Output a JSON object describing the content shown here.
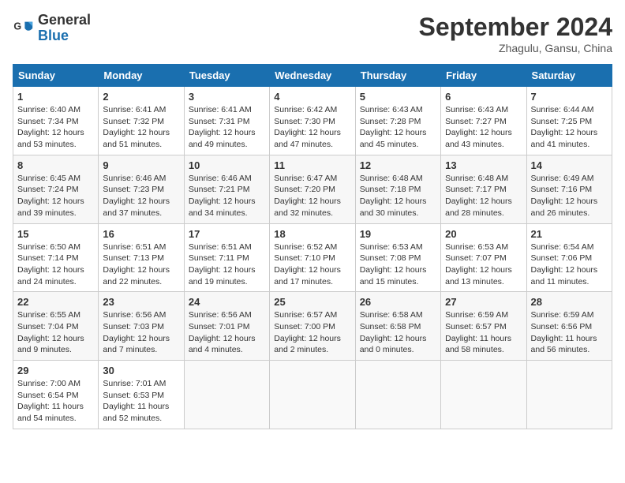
{
  "logo": {
    "line1": "General",
    "line2": "Blue"
  },
  "title": "September 2024",
  "location": "Zhagulu, Gansu, China",
  "weekdays": [
    "Sunday",
    "Monday",
    "Tuesday",
    "Wednesday",
    "Thursday",
    "Friday",
    "Saturday"
  ],
  "weeks": [
    [
      {
        "day": "1",
        "sunrise": "6:40 AM",
        "sunset": "7:34 PM",
        "daylight": "12 hours and 53 minutes."
      },
      {
        "day": "2",
        "sunrise": "6:41 AM",
        "sunset": "7:32 PM",
        "daylight": "12 hours and 51 minutes."
      },
      {
        "day": "3",
        "sunrise": "6:41 AM",
        "sunset": "7:31 PM",
        "daylight": "12 hours and 49 minutes."
      },
      {
        "day": "4",
        "sunrise": "6:42 AM",
        "sunset": "7:30 PM",
        "daylight": "12 hours and 47 minutes."
      },
      {
        "day": "5",
        "sunrise": "6:43 AM",
        "sunset": "7:28 PM",
        "daylight": "12 hours and 45 minutes."
      },
      {
        "day": "6",
        "sunrise": "6:43 AM",
        "sunset": "7:27 PM",
        "daylight": "12 hours and 43 minutes."
      },
      {
        "day": "7",
        "sunrise": "6:44 AM",
        "sunset": "7:25 PM",
        "daylight": "12 hours and 41 minutes."
      }
    ],
    [
      {
        "day": "8",
        "sunrise": "6:45 AM",
        "sunset": "7:24 PM",
        "daylight": "12 hours and 39 minutes."
      },
      {
        "day": "9",
        "sunrise": "6:46 AM",
        "sunset": "7:23 PM",
        "daylight": "12 hours and 37 minutes."
      },
      {
        "day": "10",
        "sunrise": "6:46 AM",
        "sunset": "7:21 PM",
        "daylight": "12 hours and 34 minutes."
      },
      {
        "day": "11",
        "sunrise": "6:47 AM",
        "sunset": "7:20 PM",
        "daylight": "12 hours and 32 minutes."
      },
      {
        "day": "12",
        "sunrise": "6:48 AM",
        "sunset": "7:18 PM",
        "daylight": "12 hours and 30 minutes."
      },
      {
        "day": "13",
        "sunrise": "6:48 AM",
        "sunset": "7:17 PM",
        "daylight": "12 hours and 28 minutes."
      },
      {
        "day": "14",
        "sunrise": "6:49 AM",
        "sunset": "7:16 PM",
        "daylight": "12 hours and 26 minutes."
      }
    ],
    [
      {
        "day": "15",
        "sunrise": "6:50 AM",
        "sunset": "7:14 PM",
        "daylight": "12 hours and 24 minutes."
      },
      {
        "day": "16",
        "sunrise": "6:51 AM",
        "sunset": "7:13 PM",
        "daylight": "12 hours and 22 minutes."
      },
      {
        "day": "17",
        "sunrise": "6:51 AM",
        "sunset": "7:11 PM",
        "daylight": "12 hours and 19 minutes."
      },
      {
        "day": "18",
        "sunrise": "6:52 AM",
        "sunset": "7:10 PM",
        "daylight": "12 hours and 17 minutes."
      },
      {
        "day": "19",
        "sunrise": "6:53 AM",
        "sunset": "7:08 PM",
        "daylight": "12 hours and 15 minutes."
      },
      {
        "day": "20",
        "sunrise": "6:53 AM",
        "sunset": "7:07 PM",
        "daylight": "12 hours and 13 minutes."
      },
      {
        "day": "21",
        "sunrise": "6:54 AM",
        "sunset": "7:06 PM",
        "daylight": "12 hours and 11 minutes."
      }
    ],
    [
      {
        "day": "22",
        "sunrise": "6:55 AM",
        "sunset": "7:04 PM",
        "daylight": "12 hours and 9 minutes."
      },
      {
        "day": "23",
        "sunrise": "6:56 AM",
        "sunset": "7:03 PM",
        "daylight": "12 hours and 7 minutes."
      },
      {
        "day": "24",
        "sunrise": "6:56 AM",
        "sunset": "7:01 PM",
        "daylight": "12 hours and 4 minutes."
      },
      {
        "day": "25",
        "sunrise": "6:57 AM",
        "sunset": "7:00 PM",
        "daylight": "12 hours and 2 minutes."
      },
      {
        "day": "26",
        "sunrise": "6:58 AM",
        "sunset": "6:58 PM",
        "daylight": "12 hours and 0 minutes."
      },
      {
        "day": "27",
        "sunrise": "6:59 AM",
        "sunset": "6:57 PM",
        "daylight": "11 hours and 58 minutes."
      },
      {
        "day": "28",
        "sunrise": "6:59 AM",
        "sunset": "6:56 PM",
        "daylight": "11 hours and 56 minutes."
      }
    ],
    [
      {
        "day": "29",
        "sunrise": "7:00 AM",
        "sunset": "6:54 PM",
        "daylight": "11 hours and 54 minutes."
      },
      {
        "day": "30",
        "sunrise": "7:01 AM",
        "sunset": "6:53 PM",
        "daylight": "11 hours and 52 minutes."
      },
      null,
      null,
      null,
      null,
      null
    ]
  ]
}
